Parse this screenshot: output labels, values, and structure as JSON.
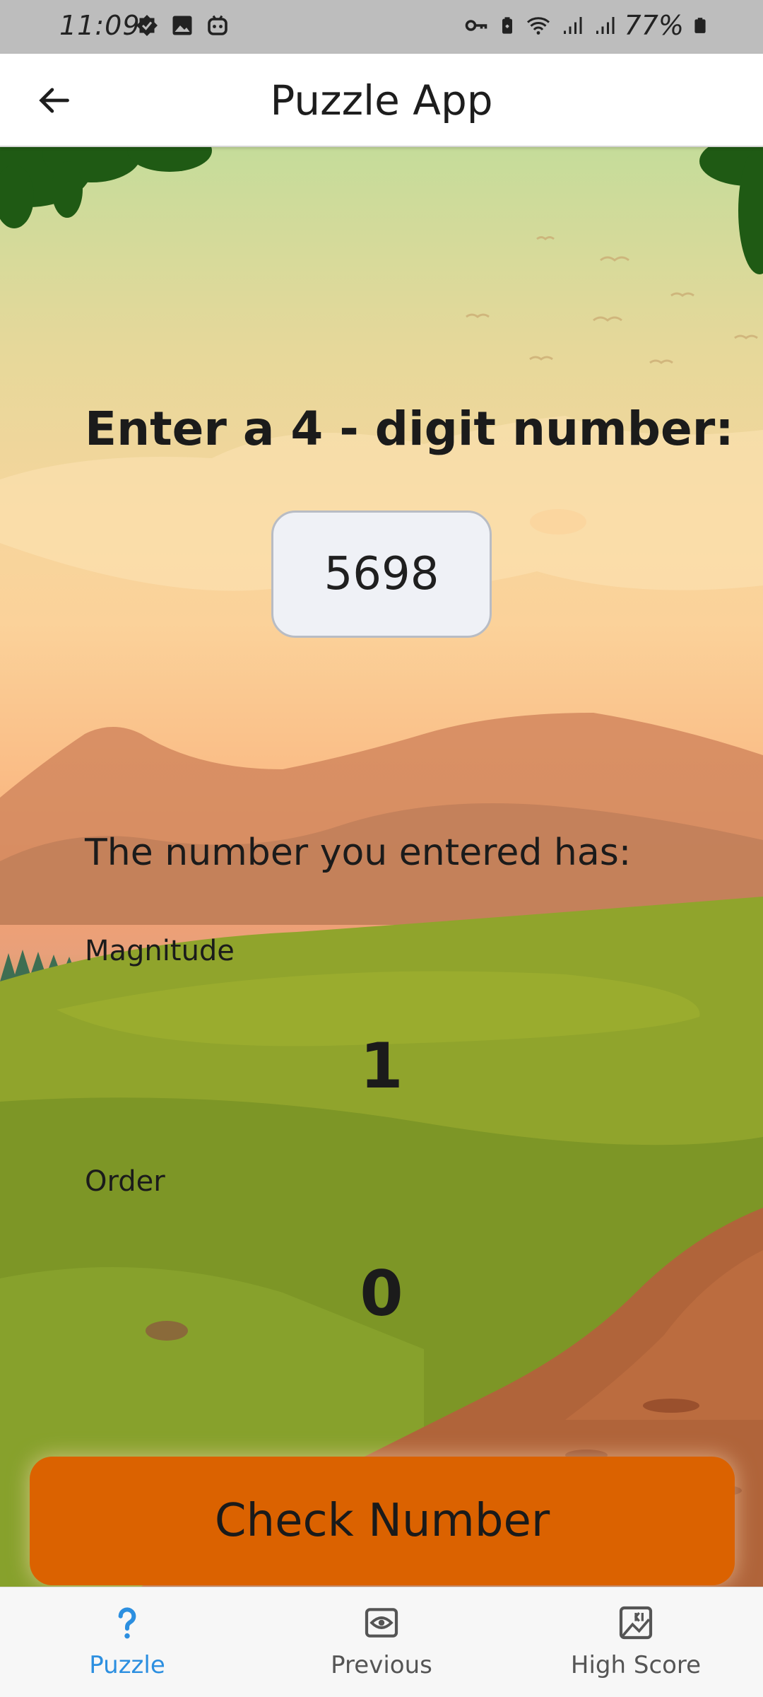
{
  "status_bar": {
    "time": "11:09",
    "battery": "77%",
    "left_icons": [
      "checkmark-badge-icon",
      "image-icon",
      "robot-icon"
    ],
    "right_icons": [
      "key-icon",
      "battery-saver-icon",
      "wifi-icon",
      "signal-icon",
      "signal-icon",
      "battery-icon"
    ]
  },
  "app_bar": {
    "title": "Puzzle App",
    "back_icon": "arrow-left-icon"
  },
  "puzzle": {
    "prompt": "Enter a 4 - digit number:",
    "input_value": "5698",
    "result_intro": "The number you entered has:",
    "magnitude_label": "Magnitude",
    "magnitude_value": "1",
    "order_label": "Order",
    "order_value": "0",
    "check_button": "Check Number"
  },
  "bottom_nav": {
    "items": [
      {
        "label": "Puzzle",
        "icon": "question-mark-icon",
        "active": true
      },
      {
        "label": "Previous",
        "icon": "eye-icon",
        "active": false
      },
      {
        "label": "High Score",
        "icon": "scoreboard-icon",
        "active": false
      }
    ]
  },
  "colors": {
    "accent": "#2c8fe0",
    "button": "#db6200",
    "input_bg": "#eff1f6"
  }
}
